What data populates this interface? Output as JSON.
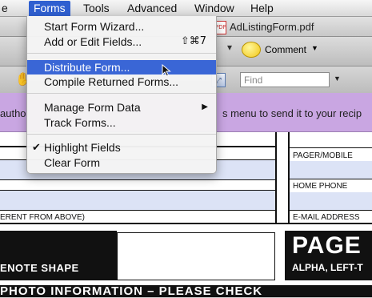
{
  "menubar": {
    "items": [
      "Forms",
      "Tools",
      "Advanced",
      "Window",
      "Help"
    ],
    "partial_left": "e"
  },
  "window": {
    "title": "AdListingForm.pdf",
    "pdf_badge": "PDF"
  },
  "toolbar": {
    "comment_label": "Comment"
  },
  "find": {
    "placeholder": "Find"
  },
  "banner": {
    "left_text": "autho",
    "text": "s menu to send it to your recip"
  },
  "forms_menu": {
    "items": [
      {
        "label": "Start Form Wizard...",
        "shortcut": ""
      },
      {
        "label": "Add or Edit Fields...",
        "shortcut": "⇧⌘7"
      },
      {
        "label": "Distribute Form...",
        "shortcut": "",
        "highlighted": true
      },
      {
        "label": "Compile Returned Forms...",
        "shortcut": ""
      },
      {
        "label": "Manage Form Data",
        "submenu": true
      },
      {
        "label": "Track Forms...",
        "shortcut": ""
      },
      {
        "label": "Highlight Fields",
        "checked": true
      },
      {
        "label": "Clear Form",
        "shortcut": ""
      }
    ]
  },
  "form": {
    "labels": {
      "pager": "PAGER/MOBILE",
      "home_phone": "HOME PHONE",
      "email": "E-MAIL ADDRESS",
      "different": "ERENT FROM ABOVE)"
    },
    "notes_shape": "ENOTE SHAPE",
    "page_heading": "PAGE",
    "alpha": "ALPHA, LEFT-T",
    "bottom": "PHOTO INFORMATION  –  PLEASE CHECK"
  },
  "colors": {
    "menu_highlight": "#3a66d6",
    "banner": "#c9a6e2",
    "field_fill": "#dce3f6"
  }
}
